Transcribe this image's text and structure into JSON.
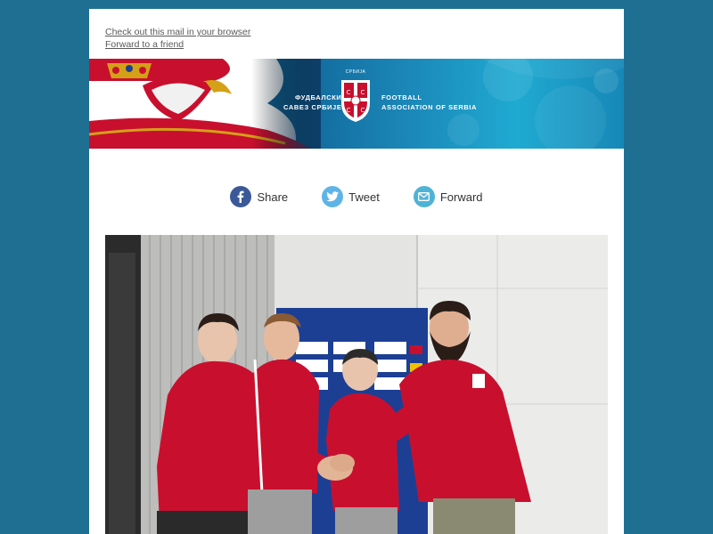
{
  "preheader": {
    "view_in_browser": "Check out this mail in your browser",
    "forward": "Forward to a friend"
  },
  "banner": {
    "left_text_line1": "ФУДБАЛСКИ",
    "left_text_line2": "САВЕЗ СРБИЈЕ",
    "right_text_line1": "FOOTBALL",
    "right_text_line2": "ASSOCIATION OF SERBIA",
    "crest_word": "СРБИЈА"
  },
  "share": {
    "facebook": "Share",
    "twitter": "Tweet",
    "forward": "Forward"
  },
  "colors": {
    "page_bg": "#1f6f92",
    "facebook": "#3b5998",
    "twitter": "#5fb4e6",
    "forward": "#4fb3d6",
    "jersey_red": "#c8102e"
  }
}
